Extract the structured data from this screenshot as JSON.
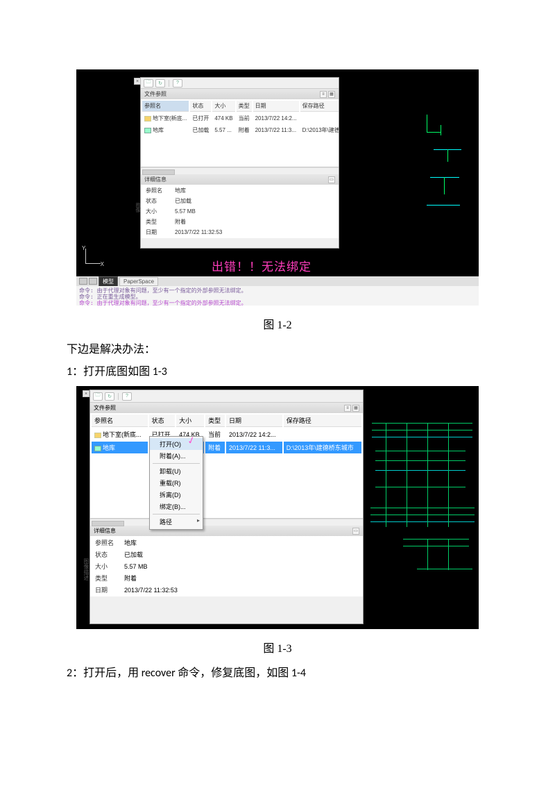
{
  "fig1": {
    "section_files": "文件参照",
    "cols": {
      "name": "参照名",
      "status": "状态",
      "size": "大小",
      "type": "类型",
      "date": "日期",
      "path": "保存路径"
    },
    "rows": [
      {
        "name": "地下室(新底...",
        "status": "已打开",
        "size": "474 KB",
        "type": "当前",
        "date": "2013/7/22 14:2...",
        "path": ""
      },
      {
        "name": "地库",
        "status": "已加载",
        "size": "5.57 ...",
        "type": "附着",
        "date": "2013/7/22 11:3...",
        "path": "D:\\2013年\\建德桥东城市"
      }
    ],
    "section_details": "详细信息",
    "details": [
      {
        "k": "参照名",
        "v": "地库"
      },
      {
        "k": "状态",
        "v": "已加载"
      },
      {
        "k": "大小",
        "v": "5.57 MB"
      },
      {
        "k": "类型",
        "v": "附着"
      },
      {
        "k": "日期",
        "v": "2013/7/22 11:32:53"
      }
    ],
    "side_label": "图像",
    "annotation": "出错！！无法绑定",
    "tabs": {
      "a": "模型",
      "b": "PaperSpace"
    },
    "cmd": [
      "命令: 由于代理对象有问题，至少有一个指定的外部参照无法绑定。",
      "命令: 正在重生成模型。",
      "命令: 由于代理对象有问题，至少有一个指定的外部参照无法绑定。"
    ]
  },
  "caption1": "图 1-2",
  "para_intro": "下边是解决办法：",
  "para_step1": "1：打开底图如图 1-3",
  "fig2": {
    "section_files": "文件参照",
    "cols": {
      "name": "参照名",
      "status": "状态",
      "size": "大小",
      "type": "类型",
      "date": "日期",
      "path": "保存路径"
    },
    "rows": [
      {
        "name": "地下室(新底...",
        "status": "已打开",
        "size": "474 KB",
        "type": "当前",
        "date": "2013/7/22 14:2...",
        "path": ""
      },
      {
        "name": "地库",
        "status": "已加载",
        "size": "5.57 ...",
        "type": "附着",
        "date": "2013/7/22 11:3...",
        "path": "D:\\2013年\\建德桥东城市"
      }
    ],
    "menu": [
      "打开(O)",
      "附着(A)...",
      "卸载(U)",
      "重载(R)",
      "拆离(D)",
      "绑定(B)...",
      "路径"
    ],
    "section_details": "详细信息",
    "details": [
      {
        "k": "参照名",
        "v": "地库"
      },
      {
        "k": "状态",
        "v": "已加载"
      },
      {
        "k": "大小",
        "v": "5.57 MB"
      },
      {
        "k": "类型",
        "v": "附着"
      },
      {
        "k": "日期",
        "v": "2013/7/22 11:32:53"
      }
    ],
    "side_label": "图像描述"
  },
  "caption2": "图 1-3",
  "para_step2": "2：打开后，用 recover 命令，修复底图，如图 1-4"
}
